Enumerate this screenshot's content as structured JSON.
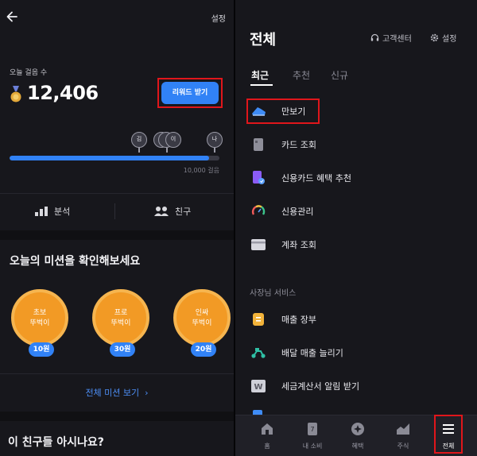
{
  "left": {
    "settings_label": "설정",
    "steps_label": "오늘 걸음 수",
    "steps_value": "12,406",
    "reward_button": "리워드 받기",
    "markers": [
      "김",
      "이",
      "나"
    ],
    "progress_fraction": 0.95,
    "goal_label": "10,000 걸음",
    "stats": [
      {
        "label": "분석",
        "icon": "bar-chart-icon"
      },
      {
        "label": "친구",
        "icon": "people-icon"
      }
    ],
    "mission_title": "오늘의 미션을 확인해보세요",
    "missions": [
      {
        "line1": "초보",
        "line2": "뚜벅이",
        "reward": "10원"
      },
      {
        "line1": "프로",
        "line2": "뚜벅이",
        "reward": "30원"
      },
      {
        "line1": "인싸",
        "line2": "뚜벅이",
        "reward": "20원"
      }
    ],
    "all_missions_label": "전체 미션 보기",
    "friends_title": "이 친구들 아시나요?"
  },
  "right": {
    "title": "전체",
    "customer_center": "고객센터",
    "settings": "설정",
    "tabs": [
      "최근",
      "추천",
      "신규"
    ],
    "active_tab": "최근",
    "recent_items": [
      {
        "label": "만보기",
        "icon": "shoe-icon"
      },
      {
        "label": "카드 조회",
        "icon": "card-icon"
      },
      {
        "label": "신용카드 혜택 추천",
        "icon": "card-benefit-icon"
      },
      {
        "label": "신용관리",
        "icon": "credit-gauge-icon"
      },
      {
        "label": "계좌 조회",
        "icon": "account-icon"
      }
    ],
    "business_section": "사장님 서비스",
    "business_items": [
      {
        "label": "매출 장부",
        "icon": "ledger-icon"
      },
      {
        "label": "배달 매출 늘리기",
        "icon": "delivery-icon"
      },
      {
        "label": "세금계산서 알림 받기",
        "icon": "invoice-icon"
      }
    ],
    "nav": [
      {
        "label": "홈",
        "icon": "home-icon"
      },
      {
        "label": "내 소비",
        "icon": "spending-icon"
      },
      {
        "label": "혜택",
        "icon": "benefit-icon"
      },
      {
        "label": "주식",
        "icon": "stocks-icon"
      },
      {
        "label": "전체",
        "icon": "menu-icon"
      }
    ],
    "active_nav": "전체"
  },
  "colors": {
    "accent_blue": "#3182f6",
    "highlight_red": "#e0161b",
    "badge_orange": "#f29a25",
    "background": "#17171c"
  }
}
